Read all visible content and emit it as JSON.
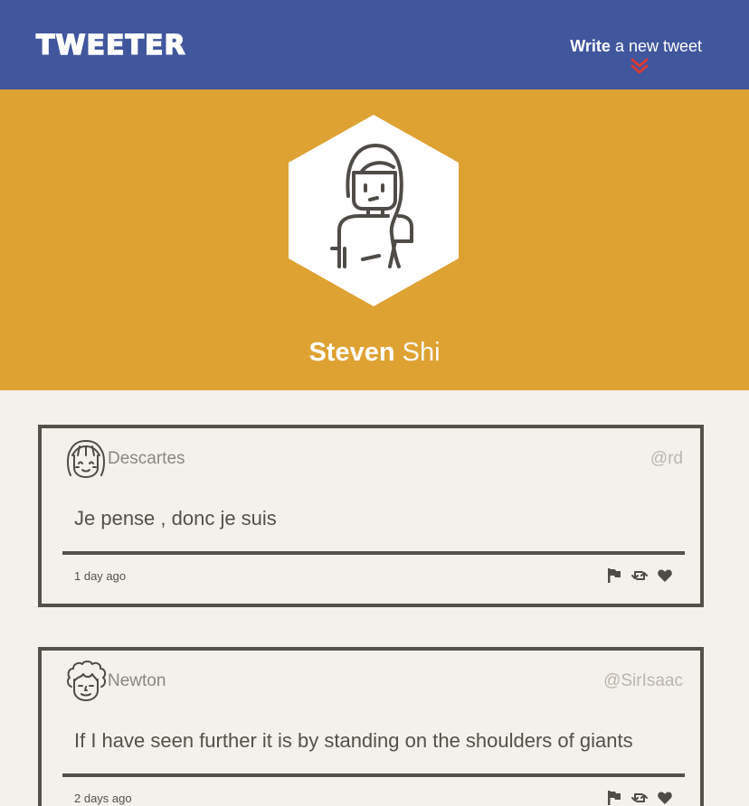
{
  "nav": {
    "logo": "TWEETER",
    "compose_strong": "Write",
    "compose_rest": " a new tweet",
    "compose_icon": "double-chevron-down-icon",
    "accent_color": "#d83a36"
  },
  "profile": {
    "first_name": "Steven",
    "last_name": " Shi",
    "avatar_icon": "female-user-avatar-icon"
  },
  "tweets": [
    {
      "name": "Descartes",
      "handle": "@rd",
      "text": "Je pense , donc je suis",
      "time": "1 day ago",
      "avatar_icon": "smiling-girl-avatar-icon"
    },
    {
      "name": "Newton",
      "handle": "@SirIsaac",
      "text": "If I have seen further it is by standing on the shoulders of giants",
      "time": "2 days ago",
      "avatar_icon": "curly-hair-avatar-icon"
    }
  ],
  "colors": {
    "nav_bg": "#40569d",
    "header_bg": "#dea233",
    "page_bg": "#f4f1ec",
    "border": "#545149"
  }
}
